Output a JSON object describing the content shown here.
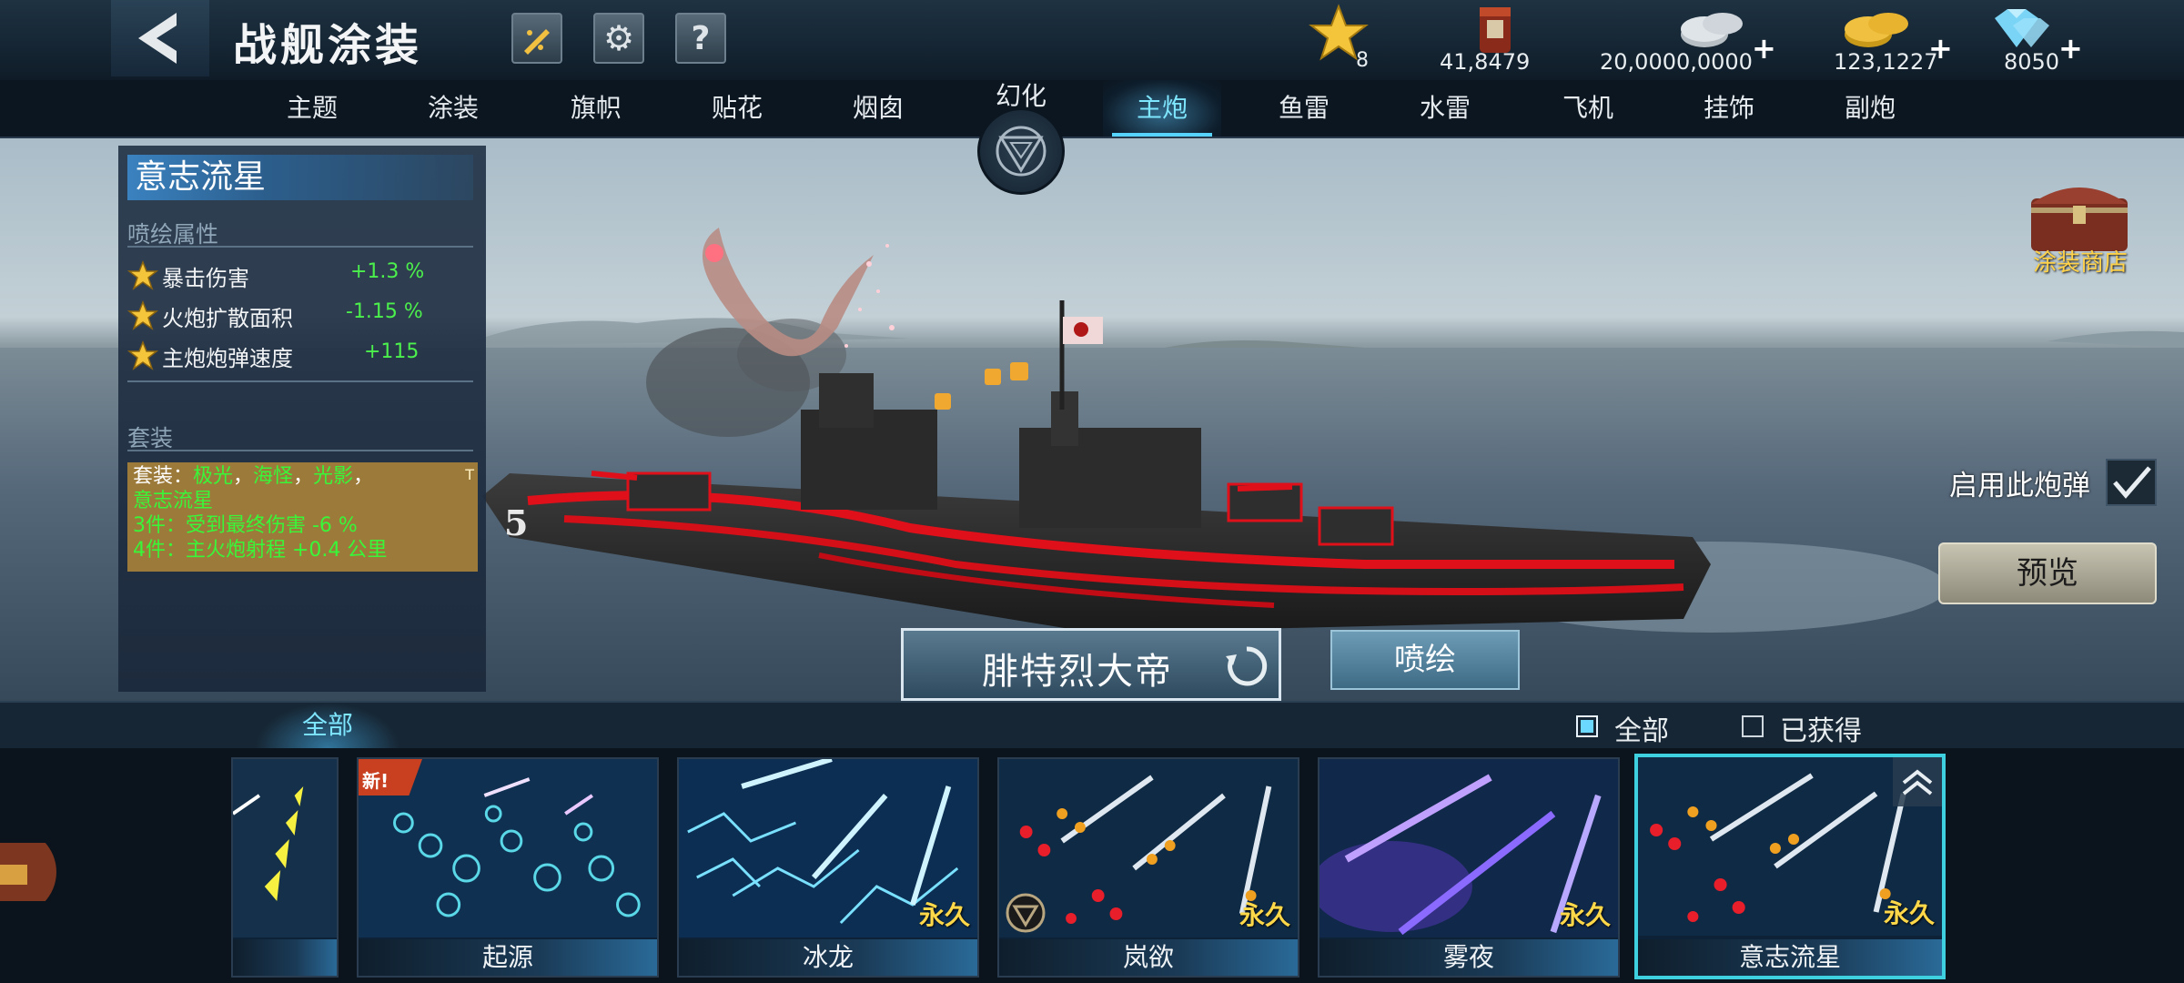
{
  "header": {
    "title": "战舰涂装",
    "resources": {
      "stars": "8",
      "paint_bucket": "41,8479",
      "silver": "20,0000,0000",
      "gold": "123,1227",
      "diamonds": "8050"
    }
  },
  "tabs": [
    "主题",
    "涂装",
    "旗帜",
    "贴花",
    "烟囱",
    "幻化",
    "主炮",
    "鱼雷",
    "水雷",
    "飞机",
    "挂饰",
    "副炮"
  ],
  "info_panel": {
    "skin_name": "意志流星",
    "spray_section": "喷绘属性",
    "attributes": [
      {
        "name": "暴击伤害",
        "value": "+1.3 %"
      },
      {
        "name": "火炮扩散面积",
        "value": "-1.15 %"
      },
      {
        "name": "主炮炮弹速度",
        "value": "+115"
      }
    ],
    "set_section": "套装",
    "set": {
      "prefix": "套装：",
      "items": [
        "极光",
        "海怪",
        "光影"
      ],
      "sep": "，",
      "item4": "意志流星",
      "bonus3": "3件：受到最终伤害 -6 %",
      "bonus4": "4件：主火炮射程 +0.4 公里",
      "corner": "T"
    }
  },
  "shop_label": "涂装商店",
  "enable_label": "启用此炮弹",
  "preview_label": "预览",
  "ship_name": "腓特烈大帝",
  "spray_label": "喷绘",
  "hull_number": "5",
  "filter": {
    "all_tab": "全部",
    "all_check": "全部",
    "owned_check": "已获得"
  },
  "cards": [
    {
      "name": "起源",
      "badge": "新!",
      "permanent": ""
    },
    {
      "name": "冰龙",
      "badge": "",
      "permanent": "永久"
    },
    {
      "name": "岚欲",
      "badge": "",
      "permanent": "永久"
    },
    {
      "name": "雾夜",
      "badge": "",
      "permanent": "永久"
    },
    {
      "name": "意志流星",
      "badge": "",
      "permanent": "永久"
    }
  ],
  "colors": {
    "accent": "#56d4ff",
    "positive": "#4cf04c",
    "set_bg": "#9c7a3a",
    "ship_red": "#e0101a"
  }
}
